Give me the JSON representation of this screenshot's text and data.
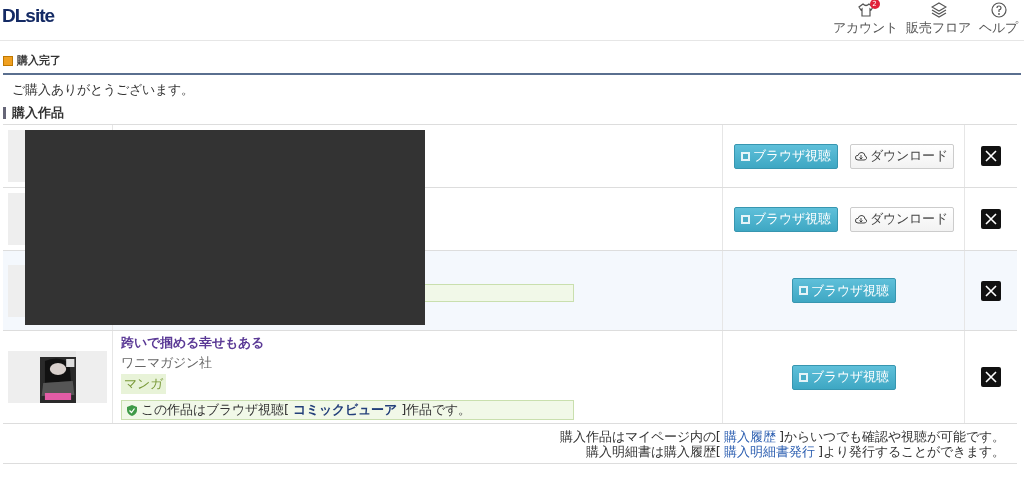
{
  "header": {
    "logo": "DLsite",
    "nav": [
      {
        "label": "アカウント",
        "badge": "2"
      },
      {
        "label": "販売フロア"
      },
      {
        "label": "ヘルプ"
      }
    ]
  },
  "page_title": "購入完了",
  "thanks": "ご購入ありがとうございます。",
  "section_title": "購入作品",
  "rows": [
    {
      "highlighted": false,
      "has_notice": false,
      "buttons": [
        {
          "kind": "browser",
          "label": "ブラウザ視聴"
        },
        {
          "kind": "download",
          "label": "ダウンロード"
        }
      ]
    },
    {
      "highlighted": false,
      "has_notice": false,
      "buttons": [
        {
          "kind": "browser",
          "label": "ブラウザ視聴"
        },
        {
          "kind": "download",
          "label": "ダウンロード"
        }
      ]
    },
    {
      "highlighted": true,
      "has_notice": true,
      "buttons": [
        {
          "kind": "browser",
          "label": "ブラウザ視聴"
        }
      ]
    },
    {
      "highlighted": false,
      "has_notice": true,
      "thumbnail": {
        "kind": "picture"
      },
      "title": "跨いで掴める幸せもある",
      "maker": "ワニマガジン社",
      "genre": "マンガ",
      "notice": "この作品はブラウザ視聴[ **コミックビューア** ]作品です。",
      "buttons": [
        {
          "kind": "browser",
          "label": "ブラウザ視聴"
        }
      ]
    }
  ],
  "footer_notes": [
    {
      "before": "購入作品はマイページ内の[",
      "link": "購入履歴",
      "after": "]からいつでも確認や視聴が可能です。"
    },
    {
      "before": "購入明細書は購入履歴[",
      "link": "購入明細書発行",
      "after": "]より発行することができます。"
    }
  ]
}
